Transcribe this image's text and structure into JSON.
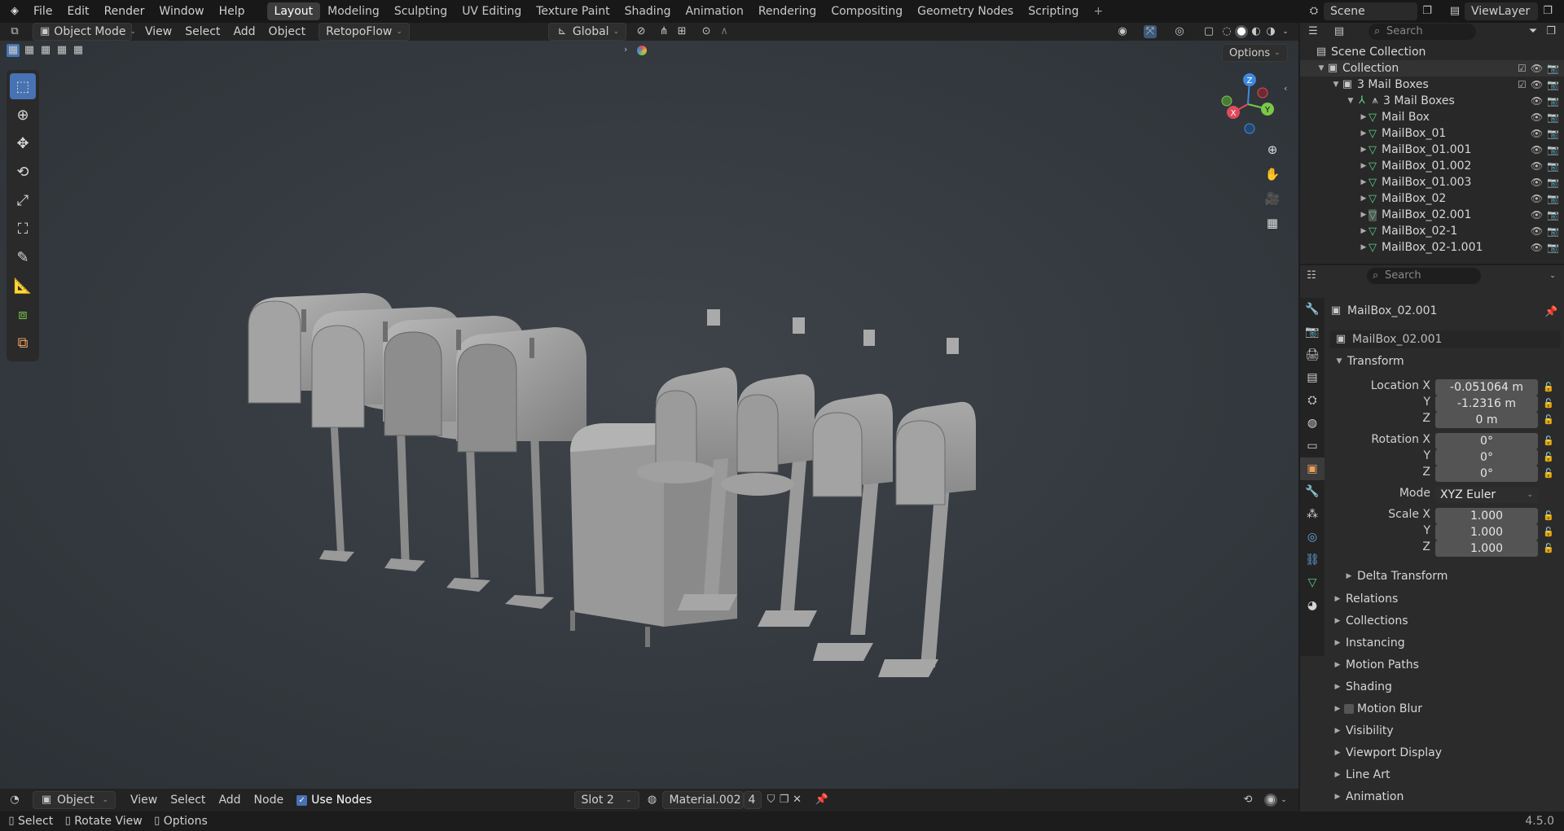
{
  "app_menu": [
    "File",
    "Edit",
    "Render",
    "Window",
    "Help"
  ],
  "workspaces": [
    "Layout",
    "Modeling",
    "Sculpting",
    "UV Editing",
    "Texture Paint",
    "Shading",
    "Animation",
    "Rendering",
    "Compositing",
    "Geometry Nodes",
    "Scripting"
  ],
  "active_workspace": "Layout",
  "scene_name": "Scene",
  "viewlayer_name": "ViewLayer",
  "viewport_header": {
    "mode": "Object Mode",
    "menus": [
      "View",
      "Select",
      "Add",
      "Object",
      "RetopoFlow"
    ],
    "orientation": "Global",
    "options_label": "Options"
  },
  "gizmo_axes": {
    "x": "X",
    "y": "Y",
    "z": "Z"
  },
  "outliner": {
    "search_placeholder": "Search",
    "scene_collection": "Scene Collection",
    "collection": "Collection",
    "group": "3 Mail Boxes",
    "empty": "3 Mail Boxes",
    "objects": [
      "Mail Box",
      "MailBox_01",
      "MailBox_01.001",
      "MailBox_01.002",
      "MailBox_01.003",
      "MailBox_02",
      "MailBox_02.001",
      "MailBox_02-1",
      "MailBox_02-1.001"
    ]
  },
  "properties": {
    "search_placeholder": "Search",
    "object_name": "MailBox_02.001",
    "object_field": "MailBox_02.001",
    "transform_label": "Transform",
    "location_label": "Location X",
    "rotation_label": "Rotation X",
    "scale_label": "Scale X",
    "mode_label": "Mode",
    "axis_y": "Y",
    "axis_z": "Z",
    "location": {
      "x": "-0.051064 m",
      "y": "-1.2316 m",
      "z": "0 m"
    },
    "rotation": {
      "x": "0°",
      "y": "0°",
      "z": "0°"
    },
    "rotation_mode": "XYZ Euler",
    "scale": {
      "x": "1.000",
      "y": "1.000",
      "z": "1.000"
    },
    "delta_transform": "Delta Transform",
    "sections": [
      "Relations",
      "Collections",
      "Instancing",
      "Motion Paths",
      "Shading",
      "Motion Blur",
      "Visibility",
      "Viewport Display",
      "Line Art",
      "Animation"
    ]
  },
  "shader_header": {
    "mode": "Object",
    "menus": [
      "View",
      "Select",
      "Add",
      "Node"
    ],
    "use_nodes": "Use Nodes",
    "slot": "Slot 2",
    "material": "Material.002",
    "users": "4"
  },
  "status_bar": {
    "select": "Select",
    "rotate": "Rotate View",
    "options": "Options",
    "version": "4.5.0"
  },
  "colors": {
    "accent": "#4772b3",
    "object_green": "#5fcf8a",
    "x_axis": "#e04a5a",
    "y_axis": "#7ac84a",
    "z_axis": "#3f8ae0"
  }
}
